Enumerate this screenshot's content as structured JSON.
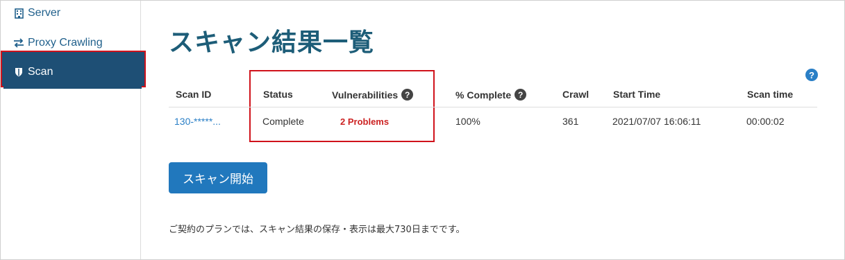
{
  "sidebar": {
    "items": [
      {
        "label": "Server",
        "icon": "building-icon"
      },
      {
        "label": "Proxy Crawling",
        "icon": "swap-arrows-icon"
      },
      {
        "label": "Scan",
        "icon": "shield-icon",
        "active": true
      }
    ]
  },
  "page": {
    "title": "スキャン結果一覧",
    "help_icon": "?"
  },
  "table": {
    "headers": [
      "Scan ID",
      "Status",
      "Vulnerabilities",
      "% Complete",
      "Crawl",
      "Start Time",
      "Scan time"
    ],
    "rows": [
      {
        "scan_id": "130-*****...",
        "status": "Complete",
        "vulnerabilities": "2 Problems",
        "complete": "100%",
        "crawl": "361",
        "start_time": "2021/07/07 16:06:11",
        "scan_time": "00:00:02"
      }
    ]
  },
  "actions": {
    "start_scan": "スキャン開始"
  },
  "notice": "ご契約のプランでは、スキャン結果の保存・表示は最大730日までです。",
  "colors": {
    "accent": "#2178bd",
    "sidebar_active": "#1e4f75",
    "highlight": "#d0121b",
    "problems": "#cc2222",
    "title": "#1d5d78"
  }
}
